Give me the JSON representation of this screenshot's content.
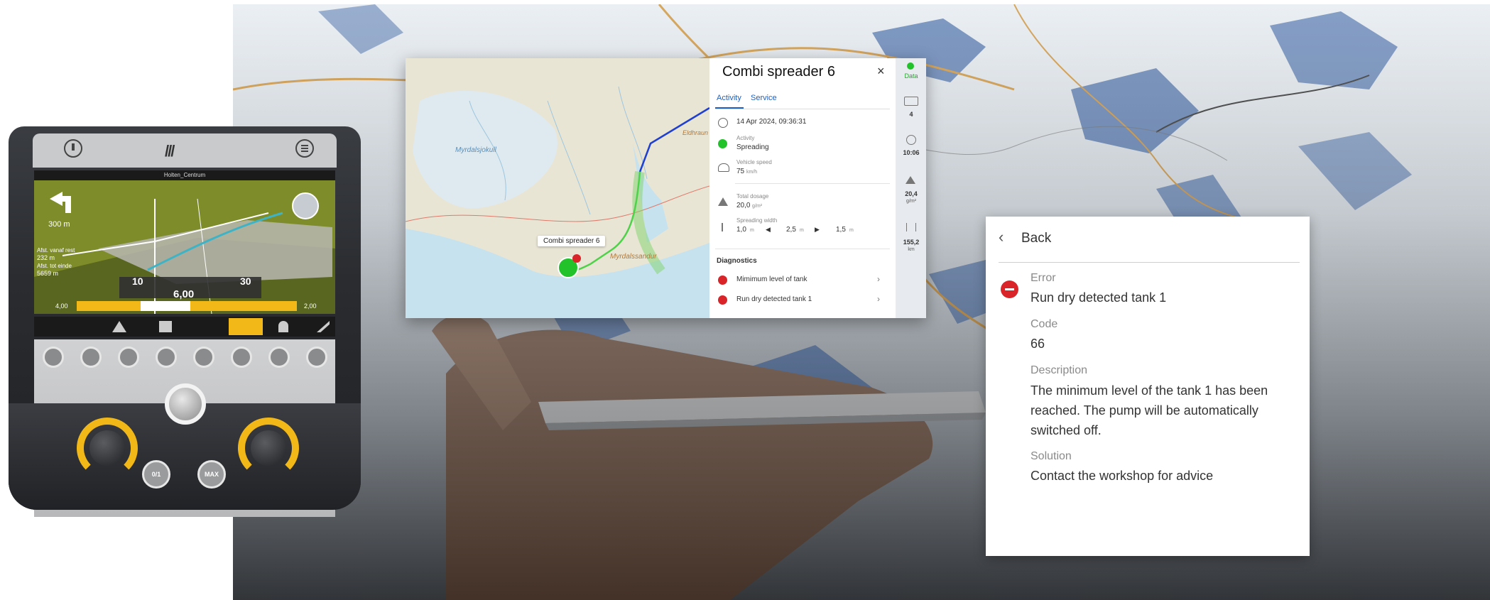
{
  "console": {
    "status_text": "Holten_Centrum",
    "dist_main": "300 m",
    "dist_lines": [
      "Afst. vanaf rest",
      "232 m",
      "Afst. tot einde",
      "5659 m"
    ],
    "gauge_left": "10",
    "gauge_right": "30",
    "rate_value": "6,00",
    "bar_min": "4,00",
    "bar_max": "2,00",
    "btn_on_off": "0/1",
    "btn_max": "MAX"
  },
  "map": {
    "labels": {
      "glacier": "Myrdalsjokull",
      "coast": "Myrdalssandur",
      "town": "Eldhraun"
    },
    "vehicle_tooltip": "Combi spreader 6"
  },
  "panel": {
    "title": "Combi spreader 6",
    "tabs": [
      "Activity",
      "Service"
    ],
    "timestamp": "14 Apr 2024, 09:36:31",
    "activity_label": "Activity",
    "activity_value": "Spreading",
    "speed_label": "Vehicle speed",
    "speed_value": "75",
    "speed_unit": "km/h",
    "dosage_label": "Total dosage",
    "dosage_value": "20,0",
    "dosage_unit": "g/m²",
    "width_label": "Spreading width",
    "width_values": [
      "1,0",
      "2,5",
      "1,5"
    ],
    "width_unit": "m",
    "diagnostics_title": "Diagnostics",
    "diagnostics": [
      "Mimimum level of tank",
      "Run dry detected tank 1"
    ]
  },
  "side": {
    "data_label": "Data",
    "count": "4",
    "time": "10:06",
    "dosage_value": "20,4",
    "dosage_unit": "g/m²",
    "distance_value": "155,2",
    "distance_unit": "km"
  },
  "error": {
    "back_label": "Back",
    "error_label": "Error",
    "error_value": "Run dry detected tank 1",
    "code_label": "Code",
    "code_value": "66",
    "description_label": "Description",
    "description_lines": [
      "The minimum level of the tank 1 has been",
      "reached. The pump will be automatically",
      "switched off."
    ],
    "solution_label": "Solution",
    "solution_value": "Contact the workshop for advice"
  },
  "colors": {
    "accent_blue": "#1f5fbf",
    "status_green": "#22c32a",
    "error_red": "#d9252a",
    "console_yellow": "#f2b817"
  }
}
